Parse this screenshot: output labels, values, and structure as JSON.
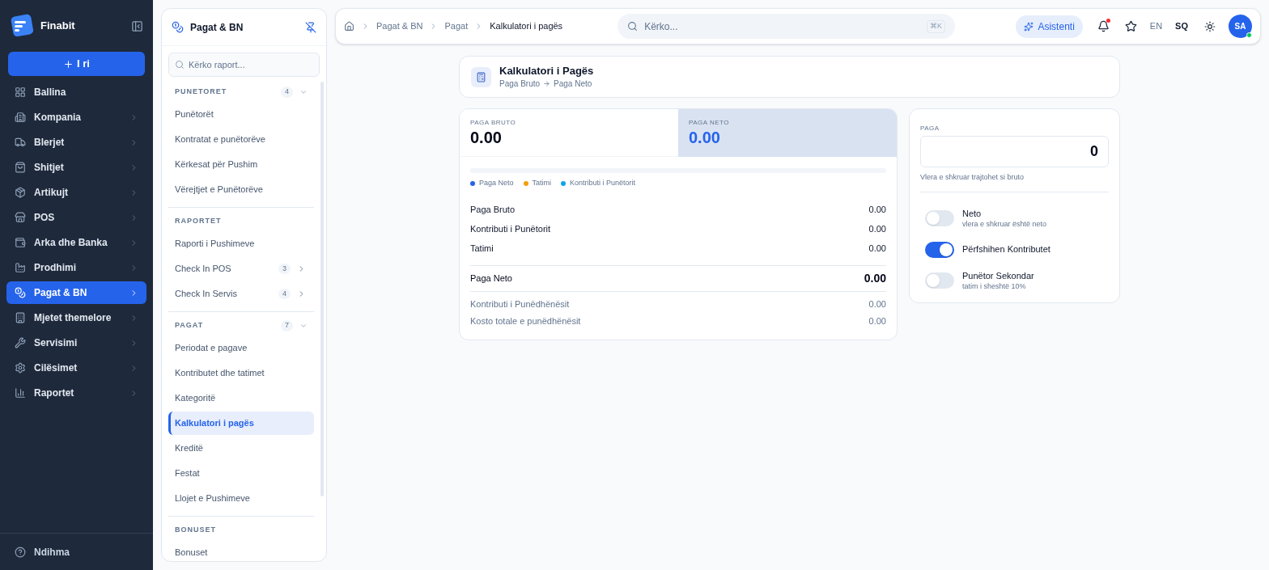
{
  "app": {
    "name": "Finabit",
    "new_button": "I ri"
  },
  "nav": [
    {
      "label": "Ballina",
      "expandable": false,
      "selected": false
    },
    {
      "label": "Kompania",
      "expandable": true,
      "selected": false
    },
    {
      "label": "Blerjet",
      "expandable": true,
      "selected": false
    },
    {
      "label": "Shitjet",
      "expandable": true,
      "selected": false
    },
    {
      "label": "Artikujt",
      "expandable": true,
      "selected": false
    },
    {
      "label": "POS",
      "expandable": true,
      "selected": false
    },
    {
      "label": "Arka dhe Banka",
      "expandable": true,
      "selected": false
    },
    {
      "label": "Prodhimi",
      "expandable": true,
      "selected": false
    },
    {
      "label": "Pagat & BN",
      "expandable": true,
      "selected": true
    },
    {
      "label": "Mjetet themelore",
      "expandable": true,
      "selected": false
    },
    {
      "label": "Servisimi",
      "expandable": true,
      "selected": false
    },
    {
      "label": "Cilësimet",
      "expandable": true,
      "selected": false
    },
    {
      "label": "Raportet",
      "expandable": true,
      "selected": false
    }
  ],
  "help": "Ndihma",
  "subpanel": {
    "title": "Pagat & BN",
    "search_placeholder": "Kërko raport...",
    "sections": [
      {
        "title": "PUNETORET",
        "count": "4",
        "expanded": true,
        "items": [
          {
            "label": "Punëtorët",
            "selected": false
          },
          {
            "label": "Kontratat e punëtorëve",
            "selected": false
          },
          {
            "label": "Kërkesat për Pushim",
            "selected": false
          },
          {
            "label": "Vërejtjet e Punëtorëve",
            "selected": false
          }
        ]
      },
      {
        "title": "RAPORTET",
        "items": [
          {
            "label": "Raporti i Pushimeve",
            "selected": false
          },
          {
            "label": "Check In POS",
            "count": "3",
            "selected": false
          },
          {
            "label": "Check In Servis",
            "count": "4",
            "selected": false
          }
        ]
      },
      {
        "title": "PAGAT",
        "count": "7",
        "expanded": true,
        "items": [
          {
            "label": "Periodat e pagave",
            "selected": false
          },
          {
            "label": "Kontributet dhe tatimet",
            "selected": false
          },
          {
            "label": "Kategoritë",
            "selected": false
          },
          {
            "label": "Kalkulatori i pagës",
            "selected": true
          },
          {
            "label": "Kreditë",
            "selected": false
          },
          {
            "label": "Festat",
            "selected": false
          },
          {
            "label": "Llojet e Pushimeve",
            "selected": false
          }
        ]
      },
      {
        "title": "BONUSET",
        "items": [
          {
            "label": "Bonuset",
            "selected": false
          }
        ]
      }
    ]
  },
  "topbar": {
    "breadcrumb": [
      "Pagat & BN",
      "Pagat",
      "Kalkulatori i pagës"
    ],
    "search_placeholder": "Kërko...",
    "shortcut": "⌘K",
    "assistant": "Asistenti",
    "notifications_unread": true,
    "languages": [
      {
        "label": "EN",
        "selected": false
      },
      {
        "label": "SQ",
        "selected": true
      }
    ],
    "avatar": "SA",
    "online": true
  },
  "page": {
    "title": "Kalkulatori i Pagës",
    "from": "Paga Bruto",
    "to": "Paga Neto"
  },
  "tiles": [
    {
      "label": "PAGA BRUTO",
      "value": "0.00",
      "selected": false
    },
    {
      "label": "PAGA NETO",
      "value": "0.00",
      "selected": true
    }
  ],
  "breakdown": [
    {
      "label": "Paga Neto",
      "color": "#2563eb"
    },
    {
      "label": "Tatimi",
      "color": "#f59e0b"
    },
    {
      "label": "Kontributi i Punëtorit",
      "color": "#0ea5e9"
    }
  ],
  "rows": [
    {
      "label": "Paga Bruto",
      "value": "0.00",
      "kind": "normal"
    },
    {
      "label": "Kontributi i Punëtorit",
      "value": "0.00",
      "kind": "normal"
    },
    {
      "label": "Tatimi",
      "value": "0.00",
      "kind": "normal"
    },
    {
      "label": "Paga Neto",
      "value": "0.00",
      "kind": "total"
    },
    {
      "label": "Kontributi i Punëdhënësit",
      "value": "0.00",
      "kind": "muted"
    },
    {
      "label": "Kosto totale e punëdhënësit",
      "value": "0.00",
      "kind": "muted"
    }
  ],
  "input": {
    "label": "PAGA",
    "value": "0",
    "hint": "Vlera e shkruar trajtohet si bruto"
  },
  "toggles": [
    {
      "label": "Neto",
      "description": "vlera e shkruar është neto",
      "on": false
    },
    {
      "label": "Përfshihen Kontributet",
      "on": true
    },
    {
      "label": "Punëtor Sekondar",
      "description": "tatim i sheshtë 10%",
      "on": false
    }
  ]
}
